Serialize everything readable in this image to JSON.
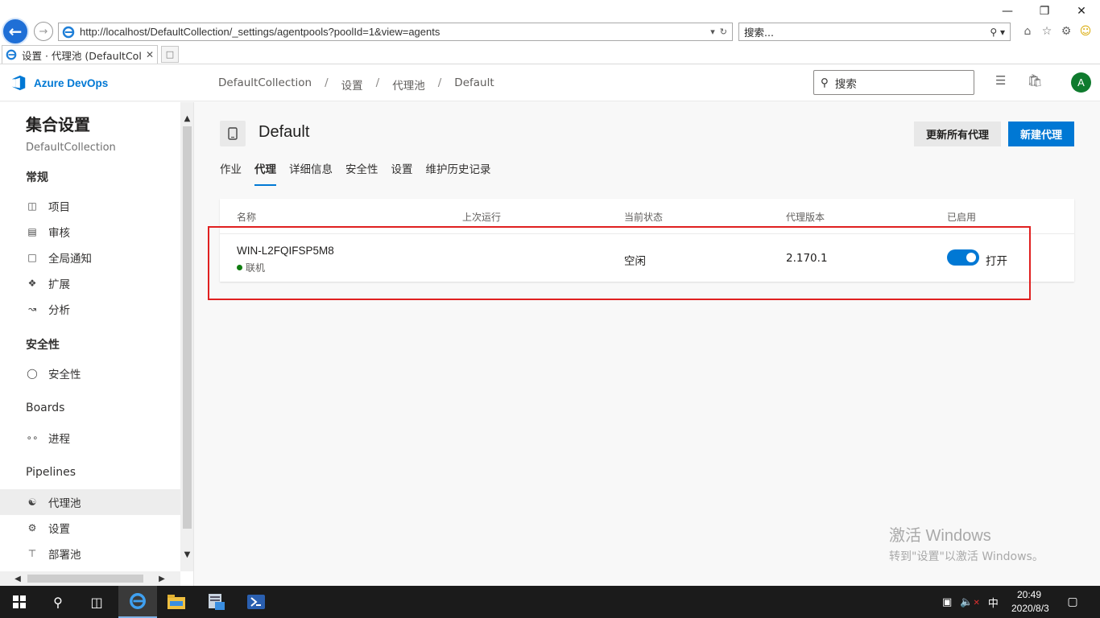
{
  "browser": {
    "url": "http://localhost/DefaultCollection/_settings/agentpools?poolId=1&view=agents",
    "search_placeholder": "搜索...",
    "tab_title": "设置 · 代理池 (DefaultColl..."
  },
  "header": {
    "logo_text": "Azure DevOps",
    "breadcrumb": [
      "DefaultCollection",
      "设置",
      "代理池",
      "Default"
    ],
    "search_placeholder": "搜索",
    "avatar_initial": "A",
    "brand_color": "#0078d4",
    "avatar_color": "#0f7b2e"
  },
  "sidebar": {
    "title": "集合设置",
    "subtitle": "DefaultCollection",
    "groups": [
      {
        "label": "常规",
        "items": [
          {
            "label": "项目",
            "icon": "projects-icon"
          },
          {
            "label": "审核",
            "icon": "audit-icon"
          },
          {
            "label": "全局通知",
            "icon": "notifications-icon"
          },
          {
            "label": "扩展",
            "icon": "extensions-icon"
          },
          {
            "label": "分析",
            "icon": "analytics-icon"
          }
        ]
      },
      {
        "label": "安全性",
        "items": [
          {
            "label": "安全性",
            "icon": "shield-icon"
          }
        ]
      },
      {
        "label": "Boards",
        "items": [
          {
            "label": "进程",
            "icon": "process-icon"
          }
        ]
      },
      {
        "label": "Pipelines",
        "items": [
          {
            "label": "代理池",
            "icon": "agent-pools-icon",
            "active": true
          },
          {
            "label": "设置",
            "icon": "gear-icon"
          },
          {
            "label": "部署池",
            "icon": "deployment-pools-icon"
          }
        ]
      }
    ]
  },
  "main": {
    "pool_name": "Default",
    "update_all_button": "更新所有代理",
    "new_agent_button": "新建代理",
    "tabs": [
      {
        "label": "作业",
        "active": false
      },
      {
        "label": "代理",
        "active": true
      },
      {
        "label": "详细信息",
        "active": false
      },
      {
        "label": "安全性",
        "active": false
      },
      {
        "label": "设置",
        "active": false
      },
      {
        "label": "维护历史记录",
        "active": false
      }
    ],
    "table": {
      "columns": [
        "名称",
        "上次运行",
        "当前状态",
        "代理版本",
        "已启用"
      ],
      "rows": [
        {
          "name": "WIN-L2FQIFSP5M8",
          "online_status": "联机",
          "last_run": "",
          "current_status": "空闲",
          "version": "2.170.1",
          "enabled": true,
          "enabled_label": "打开"
        }
      ]
    }
  },
  "watermark": {
    "line1": "激活 Windows",
    "line2": "转到\"设置\"以激活 Windows。"
  },
  "taskbar": {
    "time": "20:49",
    "date": "2020/8/3",
    "ime": "中"
  }
}
